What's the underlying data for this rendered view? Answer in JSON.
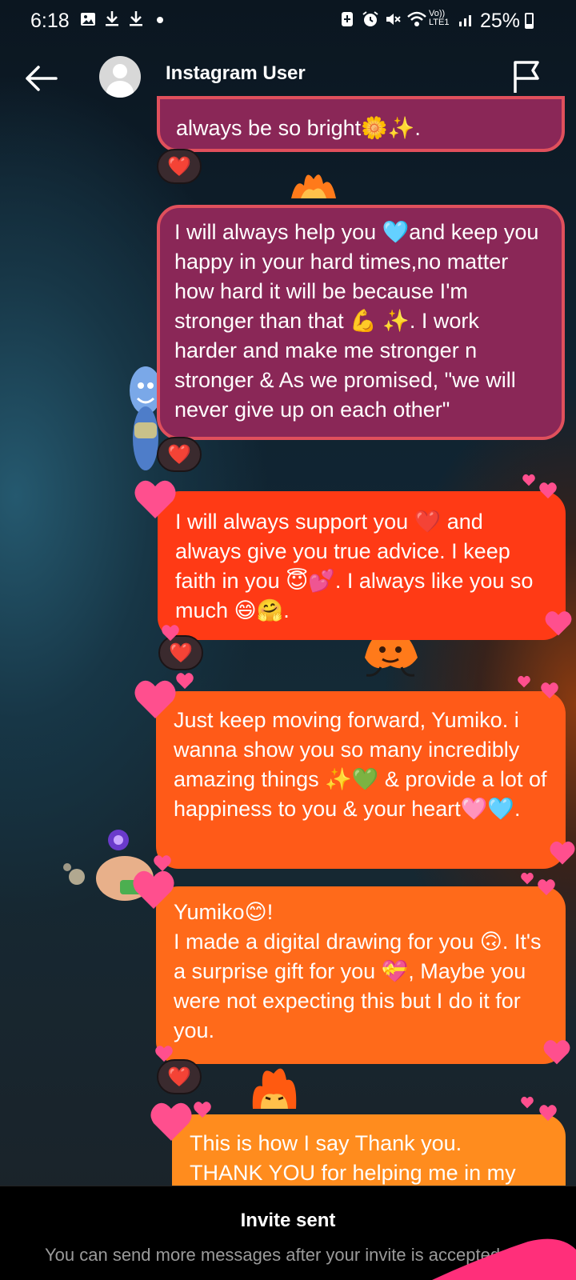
{
  "status_bar": {
    "time": "6:18",
    "battery": "25%",
    "network": "Vo)) LTE1",
    "icons_left": [
      "gallery-icon",
      "download-icon",
      "download-icon",
      "dot-icon"
    ],
    "icons_right": [
      "battery-saver-icon",
      "alarm-icon",
      "mute-icon",
      "wifi-icon",
      "signal-icon"
    ]
  },
  "header": {
    "title": "Instagram User",
    "back_icon": "back-arrow-icon",
    "report_icon": "flag-icon"
  },
  "messages": [
    {
      "text": "always be so bright🌼✨."
    },
    {
      "text": "I will always help you 🩵and keep you happy in your hard times,no matter how hard it will be because I'm stronger than that 💪 ✨. I work harder and make me stronger n stronger & As we promised, \"we will never give up on each other\""
    },
    {
      "text": "I will always support you ❤️ and always give you true advice. I keep faith in you 😇💕. I always like you so much 😄🤗."
    },
    {
      "text": "Just keep moving forward, Yumiko. i wanna show you so many incredibly amazing things ✨💚 & provide a lot of happiness to you & your heart🩷🩵."
    },
    {
      "text": "Yumiko😊!\nI made a digital drawing for you 🙃. It's a surprise gift for you 💝, Maybe you were not expecting this but I do it for you."
    },
    {
      "text": "This is how I say Thank you.\nTHANK YOU for helping me in my"
    }
  ],
  "reactions": [
    "❤️",
    "❤️",
    "❤️",
    "❤️"
  ],
  "footer": {
    "title": "Invite sent",
    "subtitle": "You can send more messages after your invite is accepted."
  },
  "colors": {
    "bubble_purple": "#8a2757",
    "bubble_red": "#ff3a15",
    "bubble_orange": "#ff6a1a",
    "heart_pink": "#ff4f8e"
  }
}
